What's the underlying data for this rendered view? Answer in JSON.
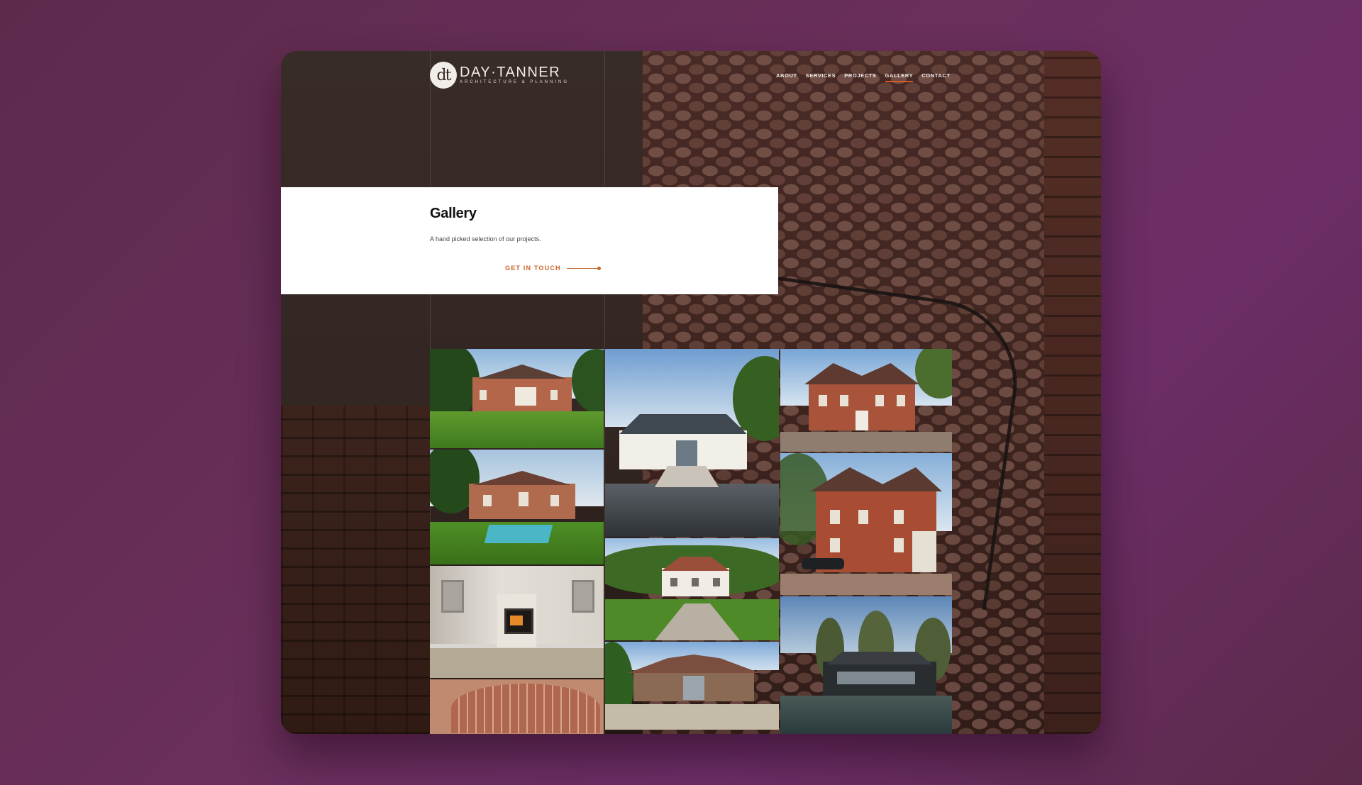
{
  "brand": {
    "mark": "dt",
    "name": "DAY·TANNER",
    "tagline": "ARCHITECTURE & PLANNING"
  },
  "nav": {
    "items": [
      "ABOUT",
      "SERVICES",
      "PROJECTS",
      "GALLERY",
      "CONTACT"
    ],
    "active": "GALLERY"
  },
  "hero": {
    "title": "Gallery",
    "description": "A hand picked selection of our projects.",
    "cta_label": "GET IN TOUCH"
  },
  "colors": {
    "accent": "#c8642c",
    "background": "#6a2f5c",
    "card": "#ffffff"
  }
}
